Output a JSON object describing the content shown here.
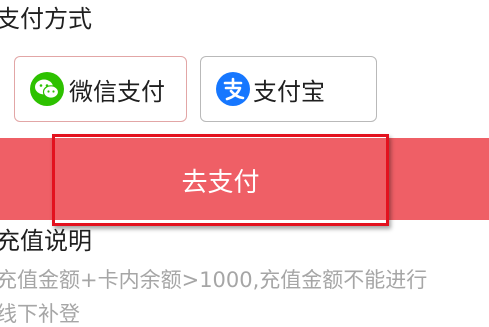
{
  "payment": {
    "section_title": "支付方式",
    "methods": [
      {
        "label": "微信支付",
        "icon": "wechat-icon",
        "selected": true
      },
      {
        "label": "支付宝",
        "icon": "alipay-icon",
        "selected": false
      }
    ]
  },
  "action": {
    "pay_label": "去支付"
  },
  "notes": {
    "title": "充值说明",
    "lines": [
      "充值金额+卡内余额>1000,充值金额不能进行",
      "线下补登"
    ]
  },
  "colors": {
    "accent": "#ef5f66",
    "wechat": "#2dc100",
    "alipay": "#1677ff",
    "selected_border": "#e2a6a6",
    "highlight": "#e3111e"
  }
}
